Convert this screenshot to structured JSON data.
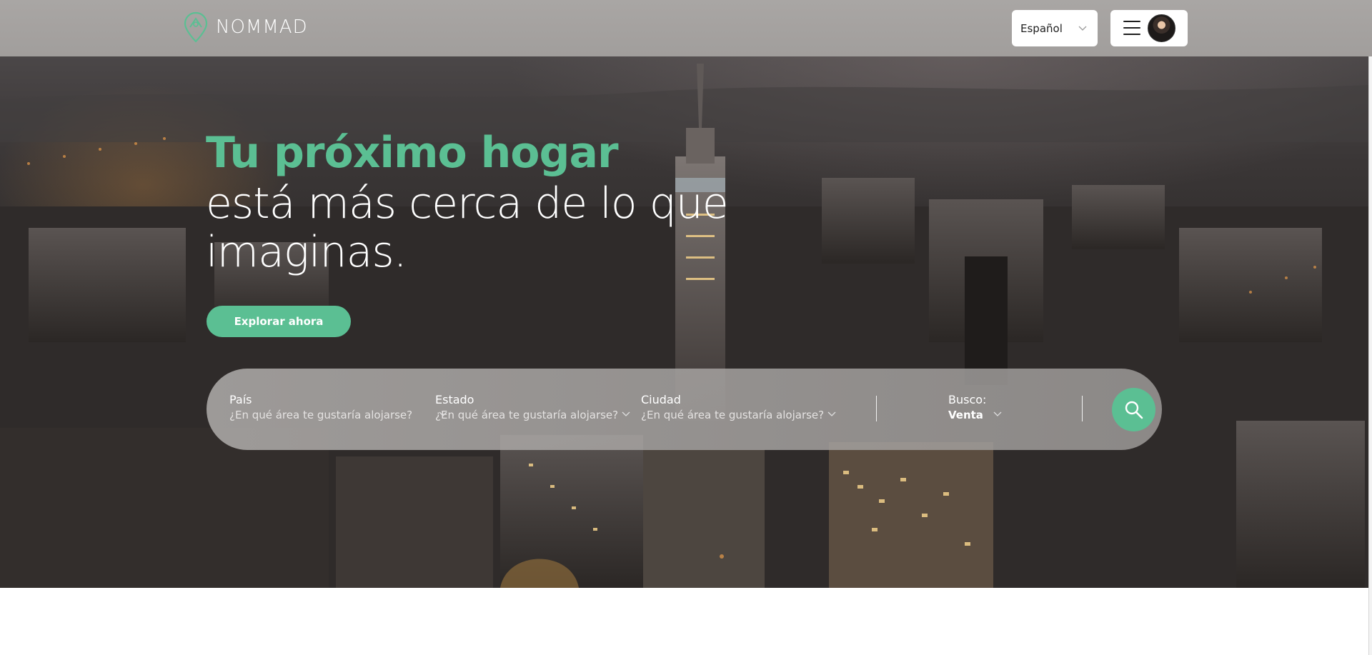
{
  "header": {
    "brand": "NOMMAD",
    "language": {
      "selected": "Español"
    },
    "menu_icon": "hamburger-icon"
  },
  "hero": {
    "title_accent": "Tu próximo hogar",
    "title_line2": "está más cerca de lo que",
    "title_line3": "imaginas.",
    "cta_label": "Explorar ahora"
  },
  "search": {
    "fields": [
      {
        "label": "País",
        "placeholder": "¿En qué área te gustaría alojarse?"
      },
      {
        "label": "Estado",
        "placeholder": "¿En qué área te gustaría alojarse?"
      },
      {
        "label": "Ciudad",
        "placeholder": "¿En qué área te gustaría alojarse?"
      }
    ],
    "busco": {
      "label": "Busco:",
      "value": "Venta"
    },
    "button_icon": "search-icon"
  },
  "colors": {
    "accent": "#5bbf93",
    "header_bg": "#a5a2a0",
    "search_bg": "#a9a6a4"
  }
}
